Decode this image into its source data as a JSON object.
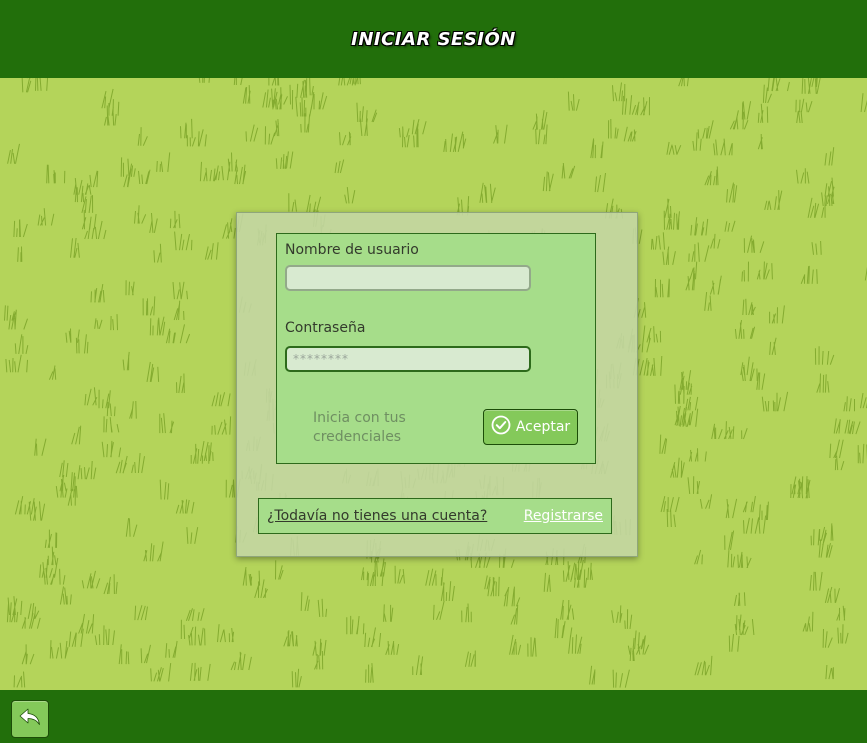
{
  "header": {
    "title": "INICIAR SESIÓN"
  },
  "login": {
    "username_label": "Nombre de usuario",
    "username_value": "",
    "password_label": "Contraseña",
    "password_placeholder": "********",
    "hint": "Inicia con tus credenciales",
    "accept_label": "Aceptar"
  },
  "register": {
    "question": "¿Todavía no tienes una cuenta?",
    "link_label": "Registrarse"
  },
  "footer": {
    "back_icon": "back-arrow-icon"
  },
  "colors": {
    "header_bg": "#226f0b",
    "grass_bg": "#b4d45a",
    "grass_stroke": "#6f9a1e",
    "panel_bg": "#a6dd8a",
    "button_bg": "#84c95a"
  }
}
